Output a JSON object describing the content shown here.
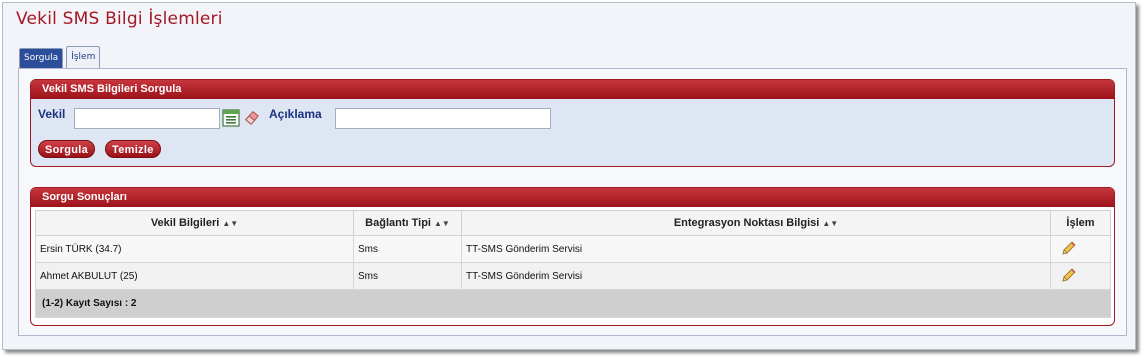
{
  "page": {
    "title": "Vekil SMS Bilgi İşlemleri"
  },
  "tabs": [
    {
      "label": "Sorgula",
      "active": true
    },
    {
      "label": "İşlem",
      "active": false
    }
  ],
  "query_panel": {
    "title": "Vekil SMS Bilgileri Sorgula",
    "vekil_label": "Vekil",
    "vekil_value": "",
    "aciklama_label": "Açıklama",
    "aciklama_value": "",
    "sorgula_button": "Sorgula",
    "temizle_button": "Temizle"
  },
  "results_panel": {
    "title": "Sorgu Sonuçları",
    "columns": [
      "Vekil Bilgileri",
      "Bağlantı Tipi",
      "Entegrasyon Noktası Bilgisi",
      "İşlem"
    ],
    "rows": [
      {
        "vekil": "Ersin TÜRK (34.7)",
        "baglanti": "Sms",
        "entegrasyon": "TT-SMS Gönderim Servisi"
      },
      {
        "vekil": "Ahmet AKBULUT (25)",
        "baglanti": "Sms",
        "entegrasyon": "TT-SMS Gönderim Servisi"
      }
    ],
    "footer": "(1-2) Kayıt Sayısı : 2"
  },
  "icons": {
    "sort": "sort-icon",
    "list": "list-icon",
    "eraser": "eraser-icon",
    "edit": "pencil-icon"
  },
  "colors": {
    "accent": "#a31822",
    "header": "#2b4d9a",
    "panel": "#dfe6f3"
  }
}
